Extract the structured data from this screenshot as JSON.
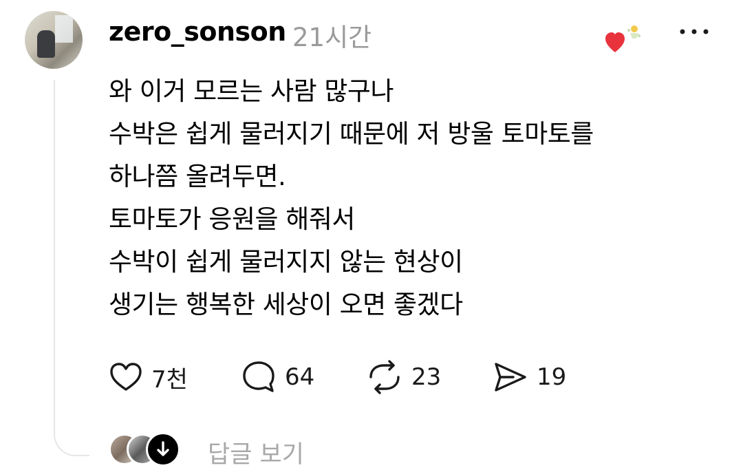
{
  "post": {
    "username": "zero_sonson",
    "timestamp": "21시간",
    "lines": [
      "와 이거 모르는 사람 많구나",
      "수박은 쉽게 물러지기 때문에 저 방울 토마토를",
      "하나쯤 올려두면.",
      "토마토가 응원을 해줘서",
      "수박이 쉽게 물러지지 않는 현상이",
      "생기는 행복한 세상이 오면 좋겠다"
    ]
  },
  "actions": {
    "like_count": "7천",
    "comment_count": "64",
    "repost_count": "23",
    "share_count": "19"
  },
  "replies": {
    "label": "답글 보기"
  },
  "colors": {
    "heart_badge": "#e8333c",
    "muted_text": "#9a9a9a",
    "thread_line": "#e6e6e6"
  }
}
